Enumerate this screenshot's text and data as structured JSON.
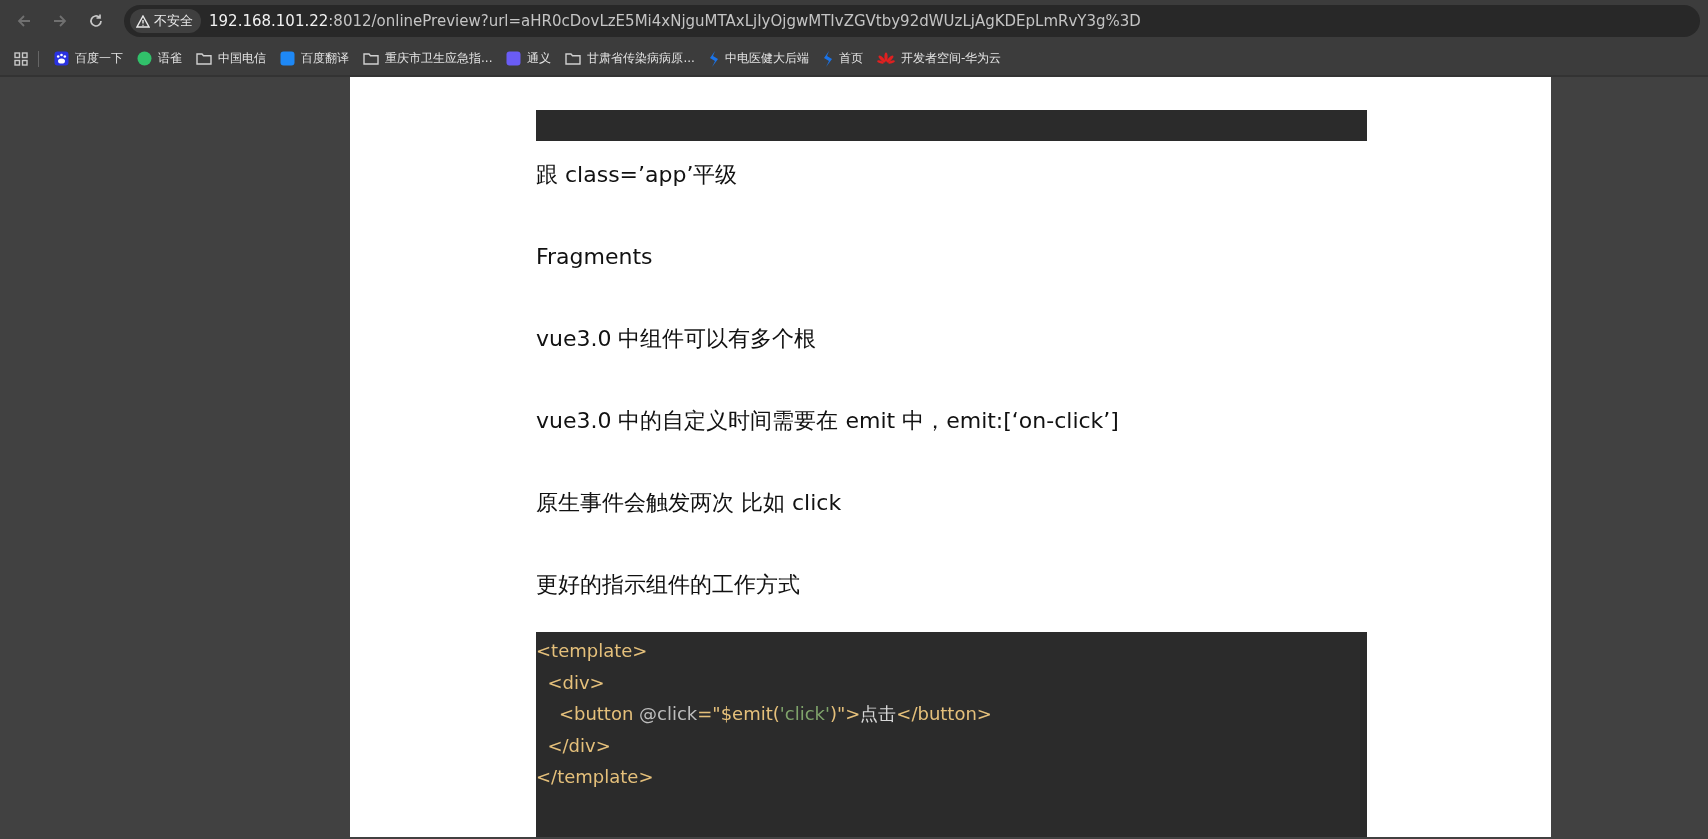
{
  "toolbar": {
    "security_label": "不安全",
    "url_host": "192.168.101.22",
    "url_rest": ":8012/onlinePreview?url=aHR0cDovLzE5Mi4xNjguMTAxLjIyOjgwMTIvZGVtby92dWUzLjAgKDEpLmRvY3g%3D"
  },
  "bookmarks": [
    {
      "label": "百度一下",
      "kind": "paw",
      "color": "#2932e1"
    },
    {
      "label": "语雀",
      "kind": "circle",
      "color": "#31c16a"
    },
    {
      "label": "中国电信",
      "kind": "folder"
    },
    {
      "label": "百度翻译",
      "kind": "square",
      "color": "#1e88f5"
    },
    {
      "label": "重庆市卫生应急指...",
      "kind": "folder"
    },
    {
      "label": "通义",
      "kind": "square",
      "color": "#6a5cf5"
    },
    {
      "label": "甘肃省传染病病原...",
      "kind": "folder"
    },
    {
      "label": "中电医健大后端",
      "kind": "mark",
      "color": "#1a73e8"
    },
    {
      "label": "首页",
      "kind": "mark",
      "color": "#1a73e8"
    },
    {
      "label": "开发者空间-华为云",
      "kind": "flower",
      "color": "#e02020"
    }
  ],
  "document": {
    "paragraphs": [
      "跟 class=’app’平级",
      "Fragments",
      "vue3.0 中组件可以有多个根",
      "vue3.0 中的自定义时间需要在 emit 中，emit:[‘on-click’]",
      "原生事件会触发两次 比如 click",
      "更好的指示组件的工作方式"
    ],
    "code_lines": [
      [
        {
          "kind": "tag",
          "text": "<template>"
        }
      ],
      [
        {
          "kind": "tag",
          "text": "  <div>"
        }
      ],
      [
        {
          "kind": "tag",
          "text": "    <button "
        },
        {
          "kind": "attr",
          "text": "@click"
        },
        {
          "kind": "tag",
          "text": "=\"$emit("
        },
        {
          "kind": "string",
          "text": "'click'"
        },
        {
          "kind": "tag",
          "text": ")\">"
        },
        {
          "kind": "plain",
          "text": "点击"
        },
        {
          "kind": "tag",
          "text": "</button>"
        }
      ],
      [
        {
          "kind": "tag",
          "text": "  </div>"
        }
      ],
      [
        {
          "kind": "tag",
          "text": "</template>"
        }
      ]
    ]
  }
}
